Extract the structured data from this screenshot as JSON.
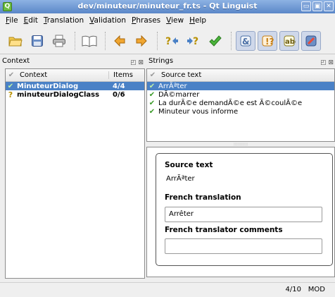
{
  "window": {
    "title": "dev/minuteur/minuteur_fr.ts - Qt Linguist",
    "app_icon": "Q"
  },
  "window_buttons": [
    "▭",
    "▣",
    "✕"
  ],
  "menu": [
    {
      "ul": "F",
      "rest": "ile"
    },
    {
      "ul": "E",
      "rest": "dit"
    },
    {
      "ul": "T",
      "rest": "ranslation"
    },
    {
      "ul": "V",
      "rest": "alidation"
    },
    {
      "ul": "P",
      "rest": "hrases"
    },
    {
      "ul": "V",
      "rest": "iew"
    },
    {
      "ul": "H",
      "rest": "elp"
    }
  ],
  "context_panel": {
    "title": "Context",
    "dock_buttons": "◰ ⊠",
    "columns": [
      "Context",
      "Items"
    ],
    "rows": [
      {
        "name": "MinuteurDialog",
        "items": "4/4",
        "status": "done",
        "selected": true
      },
      {
        "name": "minuteurDialogClass",
        "items": "0/6",
        "status": "unfinished",
        "selected": false
      }
    ]
  },
  "strings_panel": {
    "title": "Strings",
    "dock_buttons": "◰ ⊠",
    "columns": [
      "Source text"
    ],
    "rows": [
      {
        "text": "ArrÃªter",
        "selected": true
      },
      {
        "text": "DÃ©marrer",
        "selected": false
      },
      {
        "text": "La durÃ©e demandÃ©e est Ã©coulÃ©e",
        "selected": false
      },
      {
        "text": "Minuteur vous informe",
        "selected": false
      }
    ]
  },
  "editor": {
    "source_label": "Source text",
    "source_value": "ArrÃªter",
    "translation_label": "French translation",
    "translation_value": "Arrêter",
    "comments_label": "French translator comments",
    "comments_value": ""
  },
  "status": {
    "count": "4/10",
    "mode": "MOD"
  },
  "colors": {
    "selection": "#4a81c6",
    "titlebar": "#6e97d0",
    "check": "#3a9a28"
  }
}
